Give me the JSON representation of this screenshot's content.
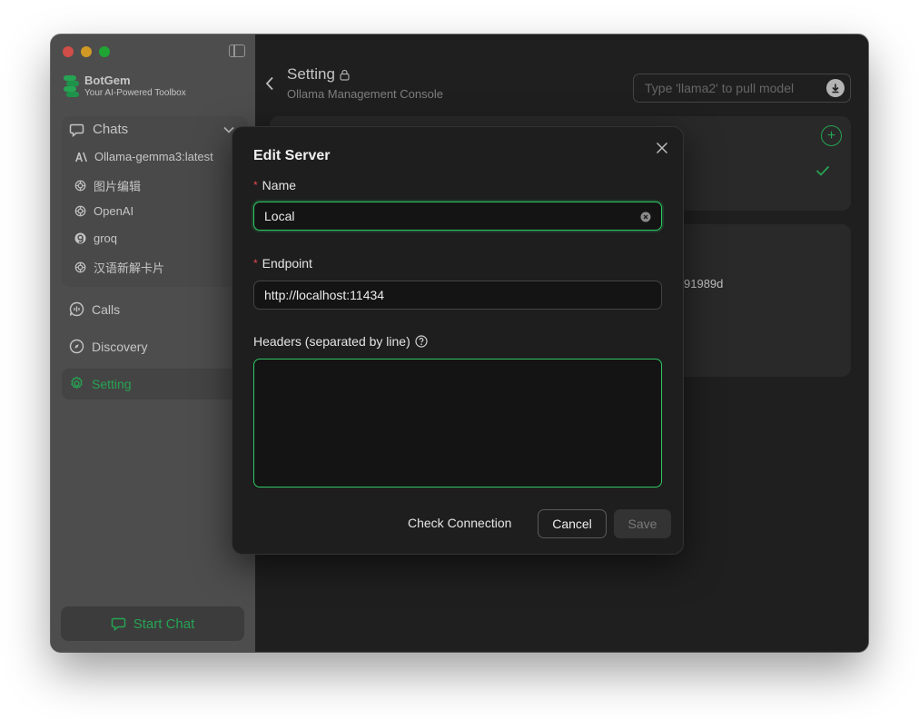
{
  "brand": {
    "name": "BotGem",
    "tagline": "Your AI-Powered Toolbox"
  },
  "sidebar": {
    "chats_label": "Chats",
    "chat_items": [
      {
        "label": "Ollama-gemma3:latest",
        "icon": "anthropic-icon"
      },
      {
        "label": "图片编辑",
        "icon": "openai-icon"
      },
      {
        "label": "OpenAI",
        "icon": "openai-icon"
      },
      {
        "label": "groq",
        "icon": "groq-icon"
      },
      {
        "label": "汉语新解卡片",
        "icon": "openai-icon"
      }
    ],
    "nav": [
      {
        "label": "Calls",
        "icon": "calls-icon"
      },
      {
        "label": "Discovery",
        "icon": "compass-icon"
      },
      {
        "label": "Setting",
        "icon": "gear-icon",
        "active": true
      }
    ],
    "start_chat_label": "Start Chat"
  },
  "header": {
    "title": "Setting",
    "subtitle": "Ollama Management Console",
    "pull_placeholder": "Type 'llama2' to pull model"
  },
  "background": {
    "hash_fragment": "91989d"
  },
  "modal": {
    "title": "Edit Server",
    "name_label": "Name",
    "name_value": "Local",
    "endpoint_label": "Endpoint",
    "endpoint_value": "http://localhost:11434",
    "headers_label": "Headers (separated by line)",
    "headers_value": "",
    "check_connection_label": "Check Connection",
    "cancel_label": "Cancel",
    "save_label": "Save"
  },
  "colors": {
    "accent": "#2fc766",
    "sidebar_bg": "#5e5e5e",
    "main_bg": "#262626",
    "modal_bg": "#1e1e1e",
    "required": "#e5484d"
  }
}
